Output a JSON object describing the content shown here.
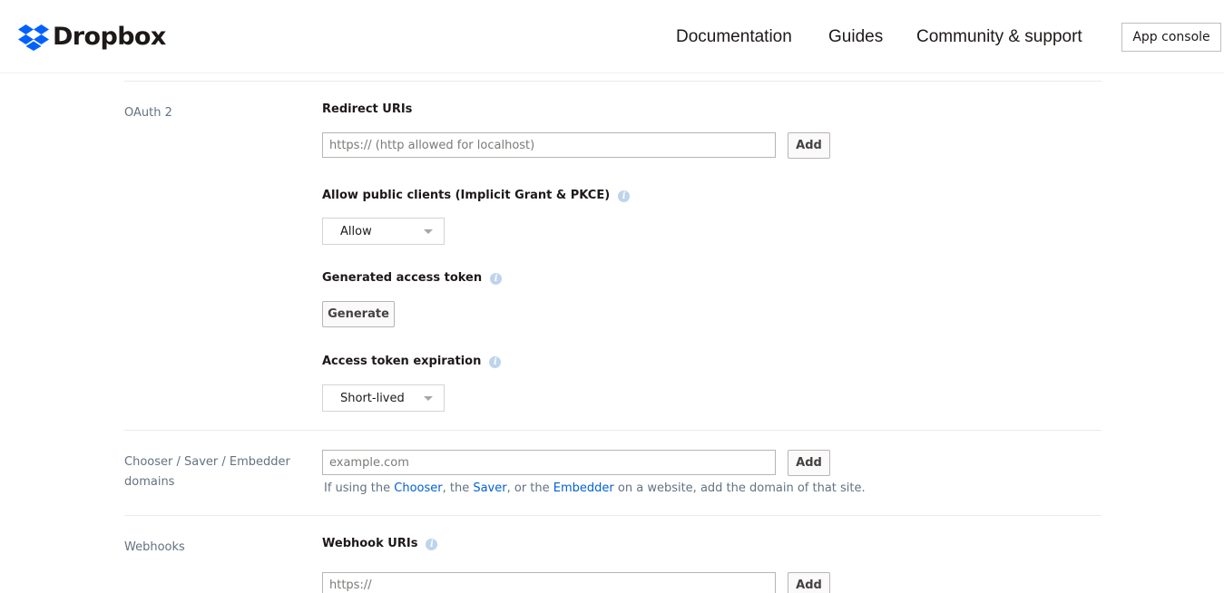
{
  "header": {
    "logo_text": "Dropbox",
    "nav": [
      "Documentation",
      "Guides",
      "Community & support"
    ],
    "app_console": "App console"
  },
  "oauth": {
    "section_label": "OAuth 2",
    "redirect_title": "Redirect URIs",
    "redirect_placeholder": "https:// (http allowed for localhost)",
    "add_label": "Add",
    "public_clients_title": "Allow public clients (Implicit Grant & PKCE)",
    "public_clients_value": "Allow",
    "access_token_title": "Generated access token",
    "generate_label": "Generate",
    "expiration_title": "Access token expiration",
    "expiration_value": "Short-lived"
  },
  "chooser": {
    "section_label_1": "Chooser / Saver / Embedder",
    "section_label_2": "domains",
    "placeholder": "example.com",
    "add_label": "Add",
    "help_prefix": "If using the ",
    "help_chooser": "Chooser",
    "help_sep1": ", the ",
    "help_saver": "Saver",
    "help_sep2": ", or the ",
    "help_embedder": "Embedder",
    "help_suffix": " on a website, add the domain of that site."
  },
  "webhooks": {
    "section_label": "Webhooks",
    "title": "Webhook URIs",
    "placeholder": "https://",
    "add_label": "Add"
  },
  "icons": {
    "info": "i",
    "brand_color": "#0061fe"
  }
}
